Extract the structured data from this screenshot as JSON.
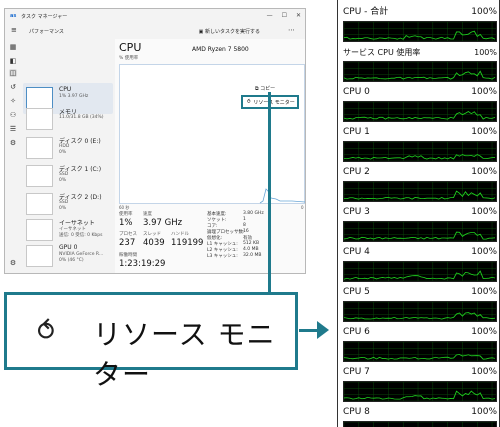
{
  "task_manager": {
    "title": "タスク マネージャー",
    "logo_text": "as",
    "page_title": "パフォーマンス",
    "new_task": "新しいタスクを実行する",
    "devices": [
      {
        "name": "CPU",
        "sub1": "1% 3.97 GHz",
        "sub2": ""
      },
      {
        "name": "メモリ",
        "sub1": "11.0/31.8 GB (34%)",
        "sub2": ""
      },
      {
        "name": "ディスク 0 (E:)",
        "sub1": "HDD",
        "sub2": "0%"
      },
      {
        "name": "ディスク 1 (C:)",
        "sub1": "SSD",
        "sub2": "0%"
      },
      {
        "name": "ディスク 2 (D:)",
        "sub1": "SSD",
        "sub2": "0%"
      },
      {
        "name": "イーサネット",
        "sub1": "イーサネット",
        "sub2": "送信: 0 受信: 0 Kbps"
      },
      {
        "name": "GPU 0",
        "sub1": "NVIDIA GeForce R...",
        "sub2": "0% (46 °C)"
      }
    ],
    "cpu_heading": "CPU",
    "cpu_model": "AMD Ryzen 7 5800",
    "utilization_label": "% 使用率",
    "graph_time_label": "60 秒",
    "graph_zero_label": "0",
    "copy_label": "コピー",
    "resource_monitor_label": "リソース モニター",
    "stats": {
      "usage_label": "使用率",
      "usage_value": "1%",
      "speed_label": "速度",
      "speed_value": "3.97 GHz",
      "process_label": "プロセス",
      "process_value": "237",
      "thread_label": "スレッド",
      "thread_value": "4039",
      "handle_label": "ハンドル",
      "handle_value": "119199",
      "uptime_label": "稼働時間",
      "uptime_value": "1:23:19:29"
    },
    "specs": [
      {
        "label": "基本速度:",
        "value": "3.80 GHz"
      },
      {
        "label": "ソケット:",
        "value": "1"
      },
      {
        "label": "コア:",
        "value": "8"
      },
      {
        "label": "論理プロセッサ数:",
        "value": "16"
      },
      {
        "label": "仮想化:",
        "value": "有効"
      },
      {
        "label": "L1 キャッシュ:",
        "value": "512 KB"
      },
      {
        "label": "L2 キャッシュ:",
        "value": "4.0 MB"
      },
      {
        "label": "L3 キャッシュ:",
        "value": "32.0 MB"
      }
    ]
  },
  "callout": {
    "label": "リソース モニター"
  },
  "resource_monitor": {
    "rows": [
      {
        "name": "CPU - 合計",
        "value": "100%"
      },
      {
        "name": "サービス CPU 使用率",
        "value": "100%"
      },
      {
        "name": "CPU 0",
        "value": "100%"
      },
      {
        "name": "CPU 1",
        "value": "100%"
      },
      {
        "name": "CPU 2",
        "value": "100%"
      },
      {
        "name": "CPU 3",
        "value": "100%"
      },
      {
        "name": "CPU 4",
        "value": "100%"
      },
      {
        "name": "CPU 5",
        "value": "100%"
      },
      {
        "name": "CPU 6",
        "value": "100%"
      },
      {
        "name": "CPU 7",
        "value": "100%"
      },
      {
        "name": "CPU 8",
        "value": "100%"
      }
    ],
    "graph_color": "#1fd11f"
  }
}
